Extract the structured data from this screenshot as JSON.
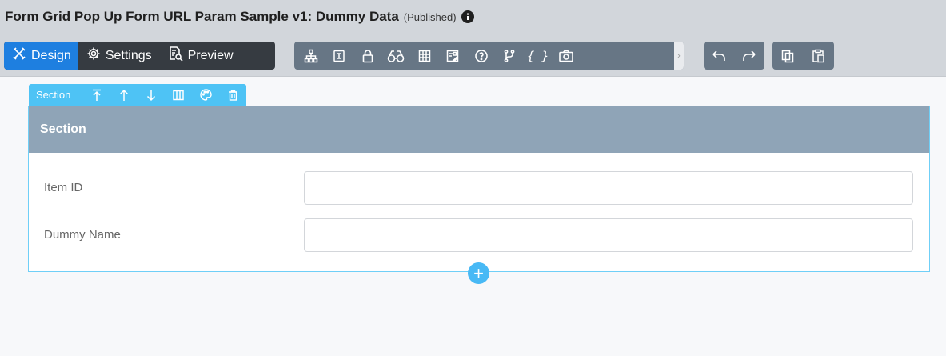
{
  "header": {
    "title": "Form Grid Pop Up Form URL Param Sample v1: Dummy Data",
    "status": "(Published)",
    "info_icon": "info-circle-icon"
  },
  "modes": [
    {
      "label": "Design",
      "icon": "design-tools-icon",
      "active": true
    },
    {
      "label": "Settings",
      "icon": "gear-icon",
      "active": false
    },
    {
      "label": "Preview",
      "icon": "document-search-icon",
      "active": false
    }
  ],
  "tools": [
    {
      "icon": "sitemap-icon"
    },
    {
      "icon": "form-field-icon"
    },
    {
      "icon": "lock-icon"
    },
    {
      "icon": "binoculars-icon"
    },
    {
      "icon": "grid-icon"
    },
    {
      "icon": "image-icon"
    },
    {
      "icon": "help-circle-icon"
    },
    {
      "icon": "branch-icon"
    },
    {
      "icon": "braces-icon",
      "text": "{ }"
    },
    {
      "icon": "camera-icon"
    }
  ],
  "tools_scroll_glyph": "›",
  "section_toolbar": {
    "label": "Section",
    "buttons": [
      "move-top-icon",
      "arrow-up-icon",
      "arrow-down-icon",
      "columns-icon",
      "palette-icon",
      "trash-icon"
    ]
  },
  "section": {
    "title": "Section",
    "fields": [
      {
        "label": "Item ID",
        "value": "",
        "placeholder": ""
      },
      {
        "label": "Dummy Name",
        "value": "",
        "placeholder": ""
      }
    ]
  },
  "add_button_glyph": "+",
  "colors": {
    "header_bg": "#d2d6db",
    "mode_active": "#1e7fe0",
    "mode_group": "#363b41",
    "toolbar_group": "#677685",
    "section_accent": "#4ec3f5",
    "section_head": "#8fa4b7"
  }
}
